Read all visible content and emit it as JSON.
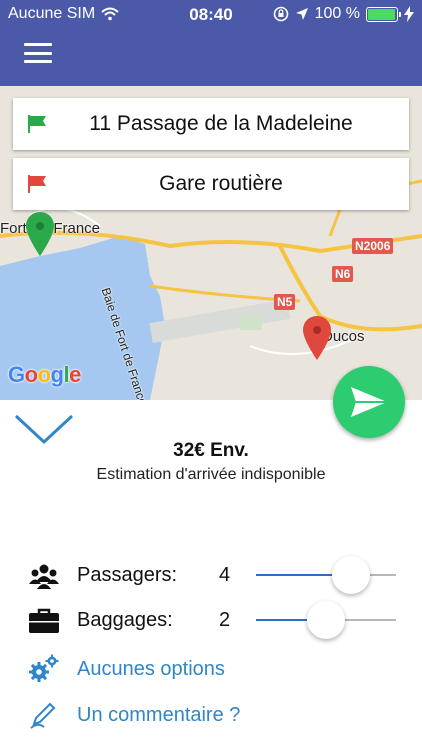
{
  "status_bar": {
    "carrier": "Aucune SIM",
    "time": "08:40",
    "battery_text": "100 %",
    "battery_level": 1.0,
    "battery_color": "#4cd964"
  },
  "header": {
    "background": "#4a5aa8",
    "menu_icon": "hamburger-menu-icon"
  },
  "route": {
    "from": {
      "label": "11 Passage de la Madeleine",
      "flag_icon": "green-flag-icon",
      "color": "#2aa84a"
    },
    "to": {
      "label": "Gare routière",
      "flag_icon": "red-flag-icon",
      "color": "#e0483d"
    }
  },
  "map": {
    "labels": {
      "city": "Fort-de-France",
      "bay": "Baie de Fort de France",
      "town": "Ducos",
      "road_n2006": "N2006",
      "road_n6": "N6",
      "road_n5": "N5"
    },
    "provider_logo": "Google",
    "pins": [
      "green-map-pin-icon",
      "red-map-pin-icon"
    ]
  },
  "trip": {
    "price": "32€ Env.",
    "eta": "Estimation d'arrivée indisponible"
  },
  "passengers": {
    "label": "Passagers:",
    "value": "4",
    "slider_fraction": 0.68,
    "icon": "group-people-icon"
  },
  "luggage": {
    "label": "Baggages:",
    "value": "2",
    "slider_fraction": 0.5,
    "icon": "briefcase-icon"
  },
  "options_link": {
    "label": "Aucunes options",
    "icon": "gears-icon"
  },
  "comment_link": {
    "label": "Un commentaire ?",
    "icon": "pen-icon"
  },
  "send_button": {
    "icon": "send-paper-plane-icon",
    "color": "#2ecc71"
  },
  "collapse_button": {
    "icon": "chevron-down-icon",
    "color": "#2f86c9"
  }
}
